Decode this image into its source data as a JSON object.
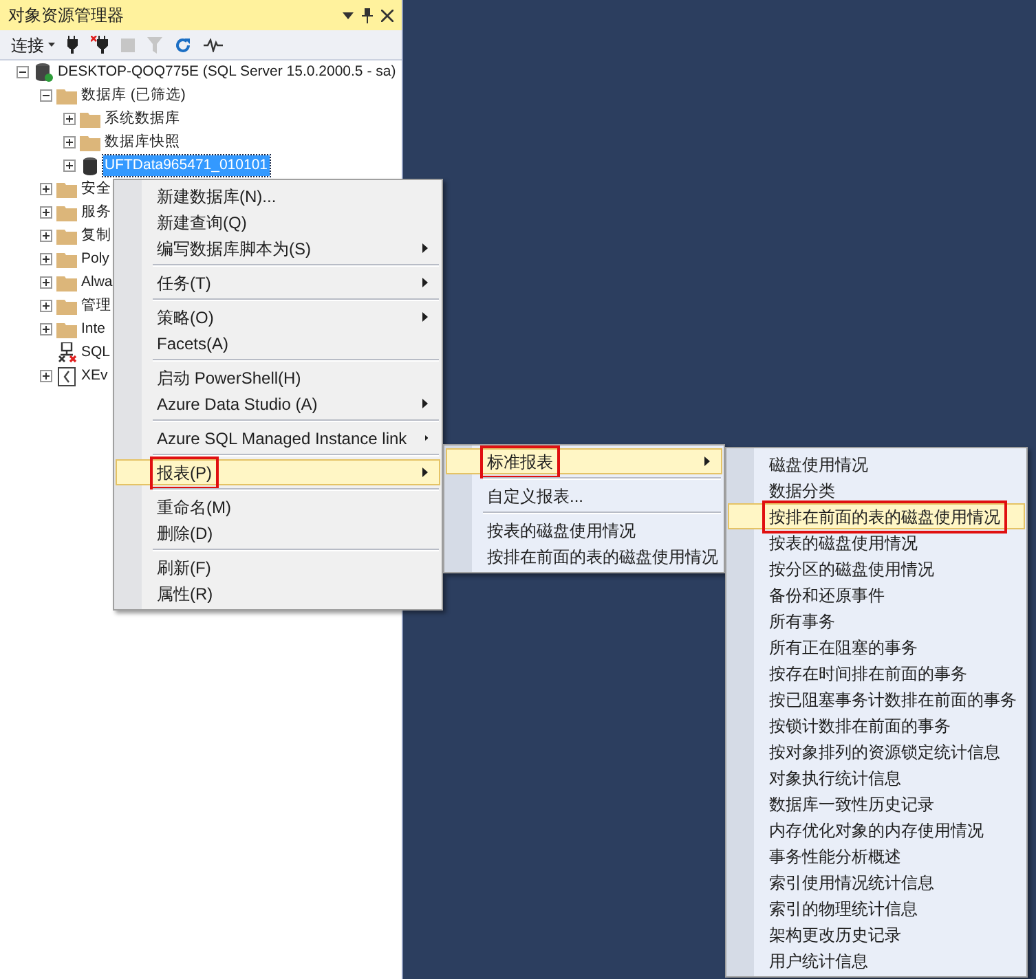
{
  "panel": {
    "title": "对象资源管理器",
    "toolbar": {
      "connect_label": "连接"
    }
  },
  "tree": [
    {
      "label": "DESKTOP-QOQ775E (SQL Server 15.0.2000.5 - sa)",
      "kind": "server",
      "expanded": true,
      "selected": false,
      "children": [
        {
          "label": "数据库 (已筛选)",
          "kind": "folder",
          "expanded": true,
          "selected": false,
          "children": [
            {
              "label": "系统数据库",
              "kind": "folder",
              "expanded": false,
              "selected": false
            },
            {
              "label": "数据库快照",
              "kind": "folder",
              "expanded": false,
              "selected": false
            },
            {
              "label": "UFTData965471_010101",
              "kind": "database",
              "expanded": false,
              "selected": true
            }
          ]
        },
        {
          "label": "安全",
          "kind": "folder",
          "expanded": false,
          "selected": false
        },
        {
          "label": "服务",
          "kind": "folder",
          "expanded": false,
          "selected": false
        },
        {
          "label": "复制",
          "kind": "folder",
          "expanded": false,
          "selected": false
        },
        {
          "label": "Poly",
          "kind": "folder",
          "expanded": false,
          "selected": false
        },
        {
          "label": "Alwa",
          "kind": "folder",
          "expanded": false,
          "selected": false
        },
        {
          "label": "管理",
          "kind": "folder",
          "expanded": false,
          "selected": false
        },
        {
          "label": "Inte",
          "kind": "folder",
          "expanded": false,
          "selected": false
        },
        {
          "label": "SQL",
          "kind": "agent",
          "selected": false
        },
        {
          "label": "XEv",
          "kind": "xevent",
          "expanded": false,
          "selected": false
        }
      ]
    }
  ],
  "context_menu": [
    {
      "kind": "item",
      "label": "新建数据库(N)...",
      "submenu": false,
      "selected": false,
      "annotated": false
    },
    {
      "kind": "item",
      "label": "新建查询(Q)",
      "submenu": false,
      "selected": false,
      "annotated": false
    },
    {
      "kind": "item",
      "label": "编写数据库脚本为(S)",
      "submenu": true,
      "selected": false,
      "annotated": false
    },
    {
      "kind": "separator"
    },
    {
      "kind": "item",
      "label": "任务(T)",
      "submenu": true,
      "selected": false,
      "annotated": false
    },
    {
      "kind": "separator"
    },
    {
      "kind": "item",
      "label": "策略(O)",
      "submenu": true,
      "selected": false,
      "annotated": false
    },
    {
      "kind": "item",
      "label": "Facets(A)",
      "submenu": false,
      "selected": false,
      "annotated": false
    },
    {
      "kind": "separator"
    },
    {
      "kind": "item",
      "label": "启动 PowerShell(H)",
      "submenu": false,
      "selected": false,
      "annotated": false
    },
    {
      "kind": "item",
      "label": "Azure Data Studio (A)",
      "submenu": true,
      "selected": false,
      "annotated": false
    },
    {
      "kind": "separator"
    },
    {
      "kind": "item",
      "label": "Azure SQL Managed Instance link",
      "submenu": true,
      "selected": false,
      "annotated": false
    },
    {
      "kind": "separator"
    },
    {
      "kind": "item",
      "label": "报表(P)",
      "submenu": true,
      "selected": true,
      "annotated": true
    },
    {
      "kind": "separator"
    },
    {
      "kind": "item",
      "label": "重命名(M)",
      "submenu": false,
      "selected": false,
      "annotated": false
    },
    {
      "kind": "item",
      "label": "删除(D)",
      "submenu": false,
      "selected": false,
      "annotated": false
    },
    {
      "kind": "separator"
    },
    {
      "kind": "item",
      "label": "刷新(F)",
      "submenu": false,
      "selected": false,
      "annotated": false
    },
    {
      "kind": "item",
      "label": "属性(R)",
      "submenu": false,
      "selected": false,
      "annotated": false
    }
  ],
  "reports_submenu": [
    {
      "kind": "item",
      "label": "标准报表",
      "submenu": true,
      "selected": true,
      "annotated": true
    },
    {
      "kind": "separator"
    },
    {
      "kind": "item",
      "label": "自定义报表...",
      "submenu": false,
      "selected": false,
      "annotated": false
    },
    {
      "kind": "separator"
    },
    {
      "kind": "item",
      "label": "按表的磁盘使用情况",
      "submenu": false,
      "selected": false,
      "annotated": false
    },
    {
      "kind": "item",
      "label": "按排在前面的表的磁盘使用情况",
      "submenu": false,
      "selected": false,
      "annotated": false
    }
  ],
  "standard_reports_submenu": [
    {
      "kind": "item",
      "label": "磁盘使用情况",
      "submenu": false,
      "selected": false,
      "annotated": false
    },
    {
      "kind": "item",
      "label": "数据分类",
      "submenu": false,
      "selected": false,
      "annotated": false
    },
    {
      "kind": "item",
      "label": "按排在前面的表的磁盘使用情况",
      "submenu": false,
      "selected": true,
      "annotated": true
    },
    {
      "kind": "item",
      "label": "按表的磁盘使用情况",
      "submenu": false,
      "selected": false,
      "annotated": false
    },
    {
      "kind": "item",
      "label": "按分区的磁盘使用情况",
      "submenu": false,
      "selected": false,
      "annotated": false
    },
    {
      "kind": "item",
      "label": "备份和还原事件",
      "submenu": false,
      "selected": false,
      "annotated": false
    },
    {
      "kind": "item",
      "label": "所有事务",
      "submenu": false,
      "selected": false,
      "annotated": false
    },
    {
      "kind": "item",
      "label": "所有正在阻塞的事务",
      "submenu": false,
      "selected": false,
      "annotated": false
    },
    {
      "kind": "item",
      "label": "按存在时间排在前面的事务",
      "submenu": false,
      "selected": false,
      "annotated": false
    },
    {
      "kind": "item",
      "label": "按已阻塞事务计数排在前面的事务",
      "submenu": false,
      "selected": false,
      "annotated": false
    },
    {
      "kind": "item",
      "label": "按锁计数排在前面的事务",
      "submenu": false,
      "selected": false,
      "annotated": false
    },
    {
      "kind": "item",
      "label": "按对象排列的资源锁定统计信息",
      "submenu": false,
      "selected": false,
      "annotated": false
    },
    {
      "kind": "item",
      "label": "对象执行统计信息",
      "submenu": false,
      "selected": false,
      "annotated": false
    },
    {
      "kind": "item",
      "label": "数据库一致性历史记录",
      "submenu": false,
      "selected": false,
      "annotated": false
    },
    {
      "kind": "item",
      "label": "内存优化对象的内存使用情况",
      "submenu": false,
      "selected": false,
      "annotated": false
    },
    {
      "kind": "item",
      "label": "事务性能分析概述",
      "submenu": false,
      "selected": false,
      "annotated": false
    },
    {
      "kind": "item",
      "label": "索引使用情况统计信息",
      "submenu": false,
      "selected": false,
      "annotated": false
    },
    {
      "kind": "item",
      "label": "索引的物理统计信息",
      "submenu": false,
      "selected": false,
      "annotated": false
    },
    {
      "kind": "item",
      "label": "架构更改历史记录",
      "submenu": false,
      "selected": false,
      "annotated": false
    },
    {
      "kind": "item",
      "label": "用户统计信息",
      "submenu": false,
      "selected": false,
      "annotated": false
    }
  ]
}
